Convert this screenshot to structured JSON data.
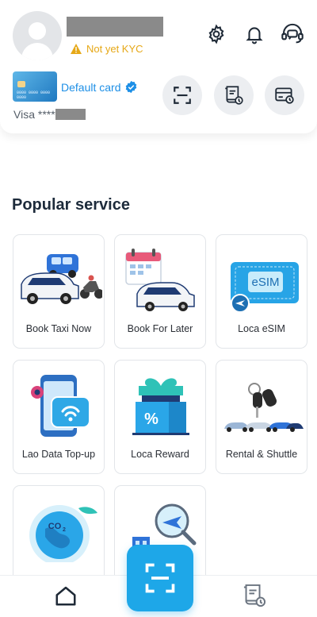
{
  "profile": {
    "kyc_status": "Not yet KYC"
  },
  "payment": {
    "card_label": "Default card",
    "card_masked_prefix": "Visa ****",
    "card_image_number": "0000 0000 0000 0000"
  },
  "section": {
    "title": "Popular service"
  },
  "services": [
    {
      "label": "Book Taxi Now",
      "icon": "taxi-cars-icon"
    },
    {
      "label": "Book For Later",
      "icon": "calendar-car-icon"
    },
    {
      "label": "Loca eSIM",
      "icon": "esim-card-icon"
    },
    {
      "label": "Lao Data Top-up",
      "icon": "phone-wifi-icon"
    },
    {
      "label": "Loca Reward",
      "icon": "gift-voucher-icon"
    },
    {
      "label": "Rental & Shuttle",
      "icon": "car-keys-icon"
    },
    {
      "label": "",
      "icon": "co2-globe-icon"
    },
    {
      "label": "",
      "icon": "airport-search-icon"
    }
  ],
  "colors": {
    "accent": "#1ea7e8",
    "link_blue": "#1d8fe6",
    "warning": "#e6a817"
  }
}
